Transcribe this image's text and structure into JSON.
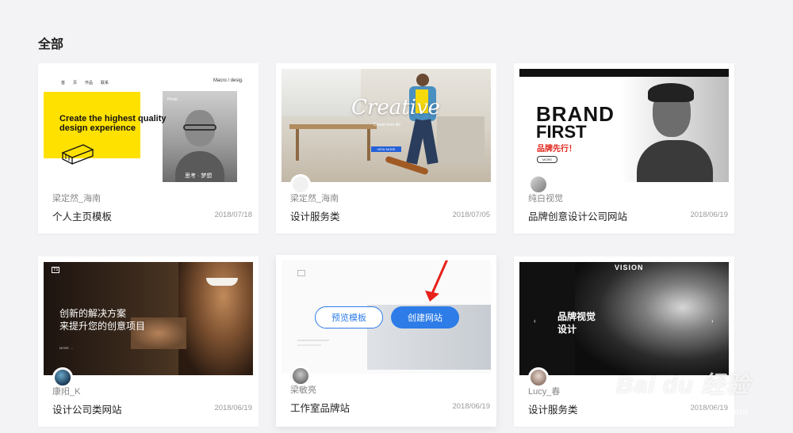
{
  "section_title": "全部",
  "cards": [
    {
      "author": "梁定然_海南",
      "name": "个人主页模板",
      "date": "2018/07/18"
    },
    {
      "author": "梁定然_海南",
      "name": "设计服务类",
      "date": "2018/07/05"
    },
    {
      "author": "纯白视觉",
      "name": "品牌创意设计公司网站",
      "date": "2018/06/19"
    },
    {
      "author": "康阳_K",
      "name": "设计公司类网站",
      "date": "2018/06/19"
    },
    {
      "author": "梁敏亮",
      "name": "工作室品牌站",
      "date": "2018/06/19"
    },
    {
      "author": "Lucy_春",
      "name": "设计服务类",
      "date": "2018/06/19"
    }
  ],
  "thumbs": {
    "t1": {
      "nav": [
        "首",
        "页",
        "作品",
        "联系"
      ],
      "logo": "Macro / desig.",
      "headline": "Create the highest quality design experience",
      "badge": "Photo",
      "sig": "思考 · 梦想"
    },
    "t2": {
      "script_text": "Creative",
      "sub": "Create from life",
      "cta": "VIEW MORE"
    },
    "t3": {
      "line1": "BRAND",
      "line2": "FIRST",
      "cn": "品牌先行！",
      "btn": "MORE"
    },
    "t4": {
      "logo": "TS",
      "line1": "创新的解决方案",
      "line2": "来提升您的创意项目",
      "link": "MORE →"
    },
    "t5": {
      "preview": "预览模板",
      "create": "创建网站"
    },
    "t6": {
      "vision": "VISION",
      "line1": "品牌视觉",
      "line2": "设计"
    }
  },
  "watermark": {
    "main": "Bai du 经验",
    "sub": "jingyan.baidu.com"
  }
}
